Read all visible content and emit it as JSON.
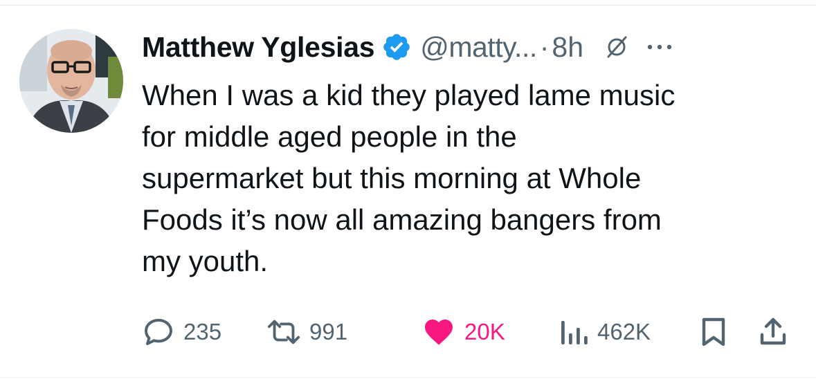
{
  "tweet": {
    "author_name": "Matthew Yglesias",
    "handle": "@matty...",
    "separator": "·",
    "time": "8h",
    "text_lines": [
      "When I was a kid they played lame music",
      "for middle aged people in the",
      "supermarket but this morning at Whole",
      "Foods it’s now all amazing bangers from",
      "my youth."
    ],
    "icons": {
      "verified": "verified-badge-icon",
      "grok": "grok-icon",
      "more": "more-options-icon"
    }
  },
  "actions": {
    "replies": "235",
    "reposts": "991",
    "likes": "20K",
    "views": "462K"
  },
  "colors": {
    "verified": "#1d9bf0",
    "secondary_text": "#536471",
    "like": "#f91880",
    "primary_text": "#0f1419"
  }
}
